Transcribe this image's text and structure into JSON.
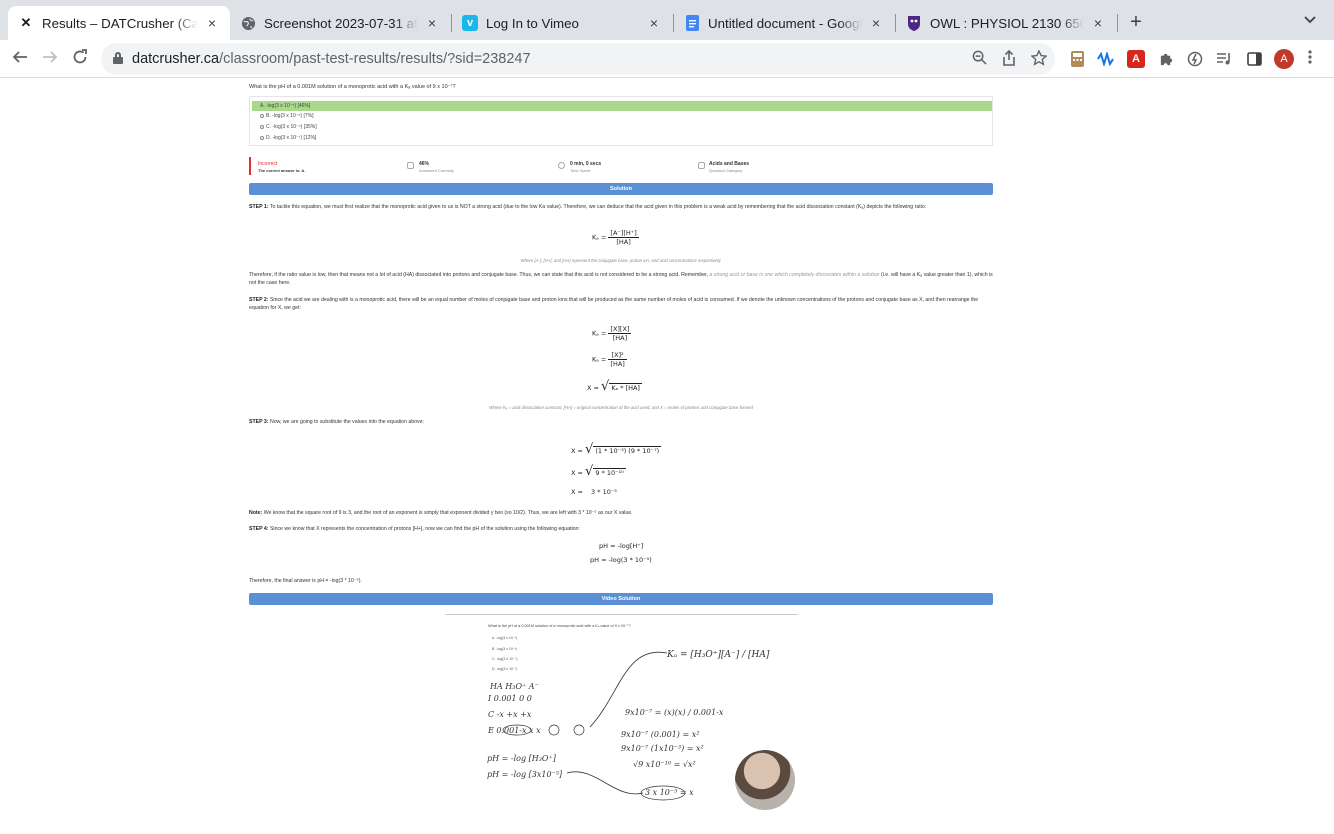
{
  "browser": {
    "tabs": [
      {
        "title": "Results – DATCrusher (Canada)",
        "icon": "datcrusher-icon",
        "active": true
      },
      {
        "title": "Screenshot 2023-07-31 at 5.0",
        "icon": "globe-icon",
        "active": false
      },
      {
        "title": "Log In to Vimeo",
        "icon": "vimeo-icon",
        "active": false
      },
      {
        "title": "Untitled document - Google Do",
        "icon": "google-docs-icon",
        "active": false
      },
      {
        "title": "OWL : PHYSIOL 2130 650 SU2",
        "icon": "owl-icon",
        "active": false
      }
    ],
    "url_host": "datcrusher.ca",
    "url_path": "/classroom/past-test-results/results/?sid=238247",
    "avatar_letter": "A"
  },
  "question": {
    "text": "What is the pH of a 0.001M solution of a monoprotic acid with a Kₐ value of 9 x 10⁻⁷?",
    "choices": [
      {
        "label": "A. -log(3 x 10⁻⁵) [46%]",
        "correct": true
      },
      {
        "label": "B. -log(3 x 10⁻⁶) [7%]",
        "correct": false
      },
      {
        "label": "C. -log(3 x 10⁻⁴) [35%]",
        "correct": false
      },
      {
        "label": "D. -log(3 x 10⁻⁷) [12%]",
        "correct": false
      }
    ]
  },
  "stats": {
    "result": "Incorrect",
    "result_sub": "The correct answer is: A.",
    "percent": "46%",
    "percent_sub": "Answered Correctly",
    "time": "0 min, 0 secs",
    "time_sub": "Time Spent",
    "category": "Acids and Bases",
    "category_sub": "Question Category"
  },
  "solution": {
    "header": "Solution",
    "step1_label": "STEP 1:",
    "step1": " To tackle this equation, we must first realize that the monoprotic acid given to us is NOT a strong acid (due to the low Ka value). Therefore, we can deduce that the acid given in this problem is a weak acid by remembering that the acid dissociation constant (Kₐ) depicts the following ratio:",
    "eq1_lhs": "Kₐ  =",
    "eq1_num": "[A⁻][H⁺]",
    "eq1_den": "[HA]",
    "note1": "Where [A-], [H+], and [HA] represent the conjugate base, proton ion, and acid concentrations respectively.",
    "para2a": "Therefore, if the ratio value is low, then that means not a lot of acid (HA) dissociated into protons and conjugate base. Thus, we can state that this acid is not considered to be a strong acid. Remember, ",
    "para2b": "a strong acid or base is one which completely dissociates within a solution",
    "para2c": " (i.e. will have a Kₐ value greater than 1), which is not the case here.",
    "step2_label": "STEP 2:",
    "step2": " Since the acid we are dealing with is a monoprotic acid, there will be an equal number of moles of conjugate base and proton ions that will be produced as the same number of moles of acid is consumed. If we denote the unknown concentrations of the protons and conjugate base as X, and then rearrange the equation for X, we get:",
    "eq2a_lhs": "Kₐ  =",
    "eq2a_num": "[X][X]",
    "eq2a_den": "[HA]",
    "eq2b_lhs": "Kₐ  =",
    "eq2b_num": "[X]²",
    "eq2b_den": "[HA]",
    "eq2c_lhs": "X  =",
    "eq2c_rad": "Kₐ * [HA]",
    "note2": "Where Kₐ = acid dissociation constant, [HA] = original concentration of the acid used, and X = moles of protons and conjugate base formed",
    "step3_label": "STEP 3:",
    "step3": " Now, we are going to substitute the values into the equation above:",
    "eq3a_lhs": "X   =",
    "eq3a_rad": "(1 * 10⁻³) (9 * 10⁻⁷)",
    "eq3b_lhs": "X   =",
    "eq3b_rad": "9 * 10⁻¹⁰",
    "eq3c_lhs": "X   =",
    "eq3c_val": "3 * 10⁻⁵",
    "note_label": "Note:",
    "note": " We know that the square root of 9 is 3, and the root of an exponent is simply that exponent divided y two (so 10/2). Thus, we are left with 3 * 10⁻⁵ as our X value.",
    "step4_label": "STEP 4:",
    "step4": " Since we know that X represents the concentration of protons [H+], now we can find the pH of the solution using the following equation:",
    "eq4a": "pH = -log[H⁺]",
    "eq4b": "pH = -log(3 * 10⁻⁵)",
    "final": "Therefore, the final answer is pH = -log(3 * 10⁻⁵)."
  },
  "video": {
    "header": "Video Solution",
    "question": "What is the pH of a 0.001M solution of a monoprotic acid with a Kₐ value of 9 x 10⁻⁷?",
    "choices": [
      "A. -log(3 x 10⁻⁵)",
      "B. -log(3 x 10⁻⁶)",
      "C. -log(3 x 10⁻⁴)",
      "D. -log(3 x 10⁻⁷)"
    ],
    "ice_header": "HA     H₃O⁺    A⁻",
    "ice_i": "I   0.001     0      0",
    "ice_c": "C   -x       +x     +x",
    "ice_e": "E  0.001-x    x      x",
    "ka_expr": "Kₐ = [H₃O⁺][A⁻] / [HA]",
    "work1": "9x10⁻⁷ = (x)(x) / 0.001-x",
    "work2": "9x10⁻⁷ (0.001) = x²",
    "work3": "9x10⁻⁷ (1x10⁻³) = x²",
    "work4": "√9 x10⁻¹⁰ = √x²",
    "work5": "3 x 10⁻⁵ = x",
    "ph1": "pH = -log [H₃O⁺]",
    "ph2": "pH = -log [3x10⁻⁵]"
  }
}
